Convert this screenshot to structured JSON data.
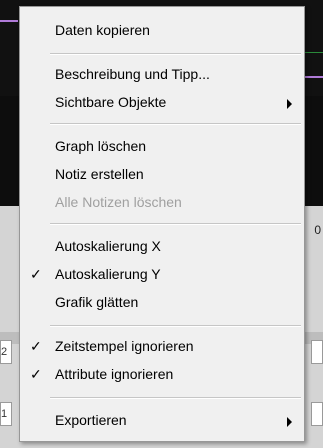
{
  "background": {
    "edge_right_value": "0",
    "edge_left_cells": [
      "2",
      "1"
    ]
  },
  "menu": {
    "items": [
      {
        "label": "Daten kopieren",
        "checked": false,
        "submenu": false,
        "disabled": false
      },
      {
        "label": "Beschreibung und Tipp...",
        "checked": false,
        "submenu": false,
        "disabled": false
      },
      {
        "label": "Sichtbare Objekte",
        "checked": false,
        "submenu": true,
        "disabled": false
      },
      {
        "label": "Graph löschen",
        "checked": false,
        "submenu": false,
        "disabled": false
      },
      {
        "label": "Notiz erstellen",
        "checked": false,
        "submenu": false,
        "disabled": false
      },
      {
        "label": "Alle Notizen löschen",
        "checked": false,
        "submenu": false,
        "disabled": true
      },
      {
        "label": "Autoskalierung X",
        "checked": false,
        "submenu": false,
        "disabled": false
      },
      {
        "label": "Autoskalierung Y",
        "checked": true,
        "submenu": false,
        "disabled": false
      },
      {
        "label": "Grafik glätten",
        "checked": false,
        "submenu": false,
        "disabled": false
      },
      {
        "label": "Zeitstempel ignorieren",
        "checked": true,
        "submenu": false,
        "disabled": false
      },
      {
        "label": "Attribute ignorieren",
        "checked": true,
        "submenu": false,
        "disabled": false
      },
      {
        "label": "Exportieren",
        "checked": false,
        "submenu": true,
        "disabled": false
      }
    ],
    "check_glyph": "✓"
  }
}
